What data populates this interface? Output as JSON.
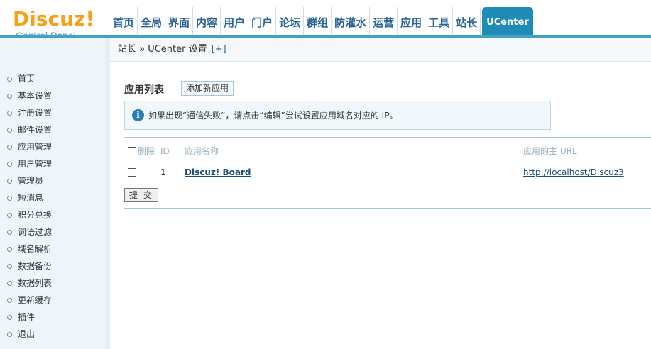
{
  "logo": {
    "main": "Discuz!",
    "sub": "Control Panel"
  },
  "topnav": [
    "首页",
    "全局",
    "界面",
    "内容",
    "用户",
    "门户",
    "论坛",
    "群组",
    "防灌水",
    "运营",
    "应用",
    "工具",
    "站长"
  ],
  "topnav_active": "UCenter",
  "breadcrumb": {
    "text": "站长 » UCenter 设置",
    "plus": "[+]"
  },
  "sidebar": [
    "首页",
    "基本设置",
    "注册设置",
    "邮件设置",
    "应用管理",
    "用户管理",
    "管理员",
    "短消息",
    "积分兑换",
    "词语过滤",
    "域名解析",
    "数据备份",
    "数据列表",
    "更新缓存",
    "插件",
    "退出"
  ],
  "main": {
    "title": "应用列表",
    "add_button": "添加新应用",
    "tip": "如果出现“通信失败”，请点击“编辑”尝试设置应用域名对应的 IP。",
    "headers": {
      "delete": "删除",
      "id": "ID",
      "name": "应用名称",
      "url": "应用的主 URL"
    },
    "rows": [
      {
        "id": "1",
        "name": "Discuz! Board",
        "url": "http://localhost/Discuz3"
      }
    ],
    "submit": "提 交"
  },
  "colors": {
    "accent": "#1f8bb7",
    "logo": "#f6a01a",
    "link": "#1d4f7a"
  }
}
